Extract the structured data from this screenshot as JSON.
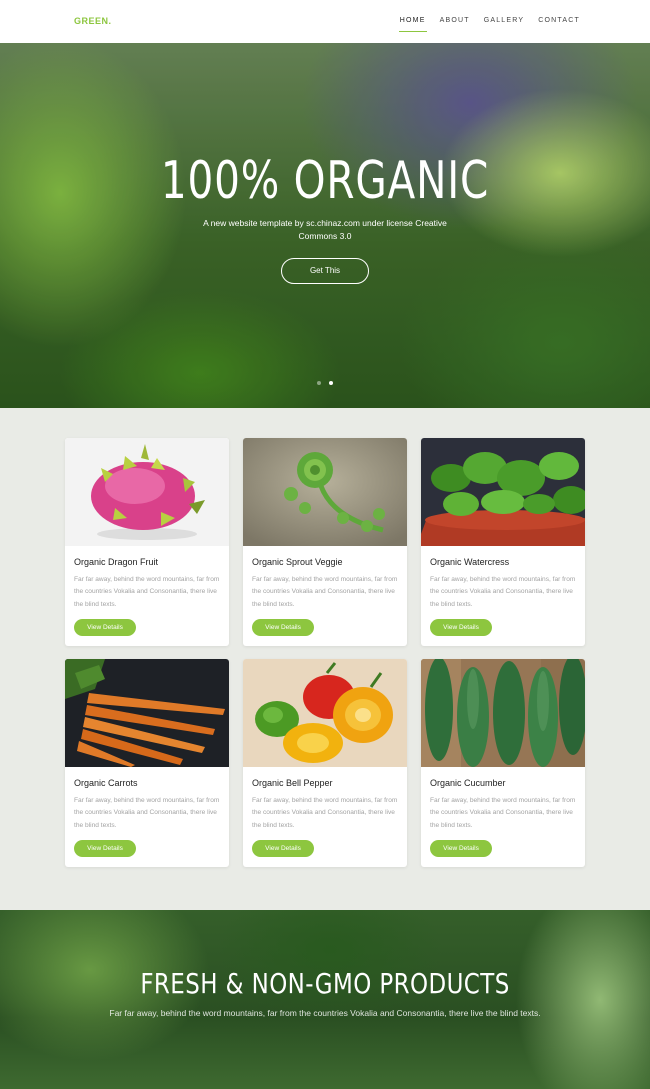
{
  "nav": {
    "brand": "GREEN.",
    "items": [
      {
        "label": "HOME",
        "active": true
      },
      {
        "label": "ABOUT",
        "active": false
      },
      {
        "label": "GALLERY",
        "active": false
      },
      {
        "label": "CONTACT",
        "active": false
      }
    ]
  },
  "hero": {
    "title": "100% ORGANIC",
    "subtitle": "A new website template by sc.chinaz.com under license Creative Commons 3.0",
    "button_label": "Get This",
    "slides": 2,
    "active_slide": 2
  },
  "products": [
    {
      "title": "Organic Dragon Fruit",
      "text": "Far far away, behind the word mountains, far from the countries Vokalia and Consonantia, there live the blind texts.",
      "button": "View Details",
      "image": "dragon-fruit"
    },
    {
      "title": "Organic Sprout Veggie",
      "text": "Far far away, behind the word mountains, far from the countries Vokalia and Consonantia, there live the blind texts.",
      "button": "View Details",
      "image": "sprout"
    },
    {
      "title": "Organic Watercress",
      "text": "Far far away, behind the word mountains, far from the countries Vokalia and Consonantia, there live the blind texts.",
      "button": "View Details",
      "image": "watercress"
    },
    {
      "title": "Organic Carrots",
      "text": "Far far away, behind the word mountains, far from the countries Vokalia and Consonantia, there live the blind texts.",
      "button": "View Details",
      "image": "carrots"
    },
    {
      "title": "Organic Bell Pepper",
      "text": "Far far away, behind the word mountains, far from the countries Vokalia and Consonantia, there live the blind texts.",
      "button": "View Details",
      "image": "bell-pepper"
    },
    {
      "title": "Organic Cucumber",
      "text": "Far far away, behind the word mountains, far from the countries Vokalia and Consonantia, there live the blind texts.",
      "button": "View Details",
      "image": "cucumber"
    }
  ],
  "fresh": {
    "title": "FRESH & NON-GMO PRODUCTS",
    "subtitle": "Far far away, behind the word mountains, far from the countries Vokalia and Consonantia, there live the blind texts."
  },
  "colors": {
    "accent": "#8dc63f",
    "page_bg": "#e9ebe6"
  }
}
